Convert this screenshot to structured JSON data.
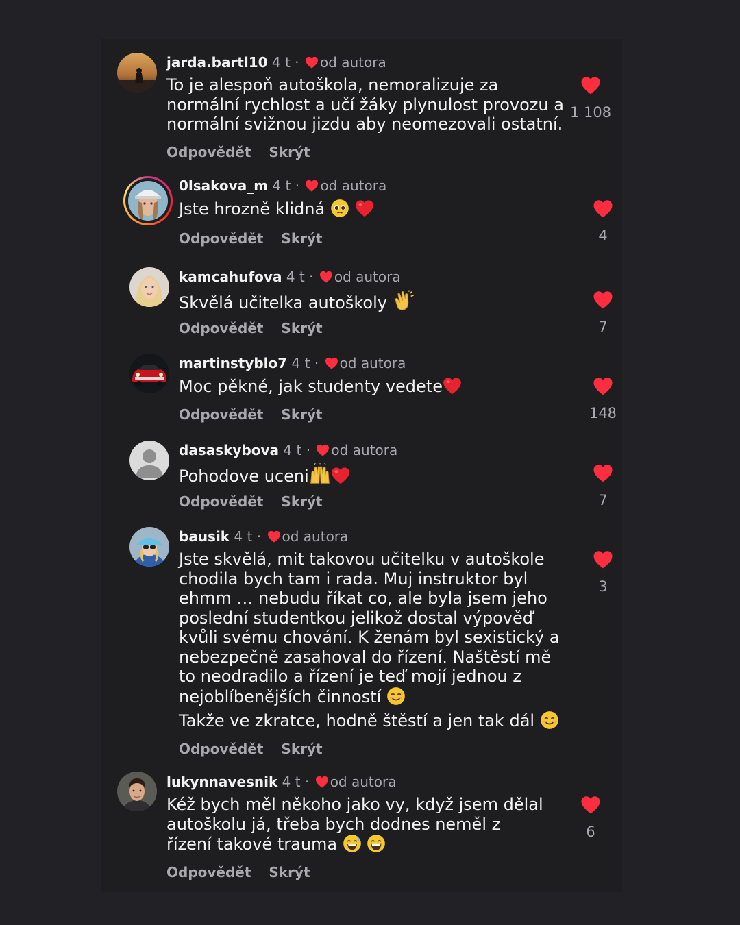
{
  "actions": {
    "reply": "Odpovědět",
    "hide": "Skrýt"
  },
  "author_label": "od autora",
  "colors": {
    "heart": "#fe2e40",
    "background": "#222226"
  },
  "comments": [
    {
      "username": "jarda.bartl10",
      "time": "4 t",
      "text": "To je alespoň autoškola, nemoralizuje za normální rychlost a učí žáky plynulost provozu a normální svižnou jizdu aby neomezovali ostatní.",
      "likes": "1 108",
      "avatar": "sunset-avatar"
    },
    {
      "username": "0lsakova_m",
      "time": "4 t",
      "text": "Jste hrozně klidná",
      "emojis": [
        "pleading-face",
        "red-heart"
      ],
      "likes": "4",
      "avatar": "woman-cap-avatar"
    },
    {
      "username": "kamcahufova",
      "time": "4 t",
      "text": "Skvělá učitelka autoškoly",
      "emojis": [
        "clapping-hands"
      ],
      "likes": "7",
      "avatar": "blonde-woman-avatar"
    },
    {
      "username": "martinstyblo7",
      "time": "4 t",
      "text": "Moc pěkné, jak studenty vedete",
      "emojis": [
        "red-heart"
      ],
      "likes": "148",
      "avatar": "red-car-avatar"
    },
    {
      "username": "dasaskybova",
      "time": "4 t",
      "text": "Pohodove uceni",
      "emojis": [
        "raising-hands",
        "red-heart"
      ],
      "likes": "7",
      "avatar": "default-user-avatar"
    },
    {
      "username": "bausik",
      "time": "4 t",
      "text": "Jste skvělá, mit takovou učitelku v autoškole chodila bych tam i rada. Muj instruktor byl ehmm … nebudu říkat co, ale byla jsem jeho poslední studentkou jelikož dostal výpověď kvůli svému chování. K ženám byl sexistický a nebezpečně zasahoval do řízení. Naštěstí mě to neodradilo a řízení je teď mojí jednou z nejoblíbenějších činností",
      "text2": "Takže ve zkratce, hodně štěstí a jen tak dál",
      "emojis": [
        "smiling-face",
        "smiling-face"
      ],
      "likes": "3",
      "avatar": "blue-hat-avatar"
    },
    {
      "username": "lukynnavesnik",
      "time": "4 t",
      "text": "Kéž bych měl někoho jako vy, když jsem dělal autoškolu já, třeba bych dodnes neměl z řízení takové trauma",
      "emojis": [
        "grinning-sweat",
        "grinning-face"
      ],
      "likes": "6",
      "avatar": "young-man-avatar"
    }
  ]
}
